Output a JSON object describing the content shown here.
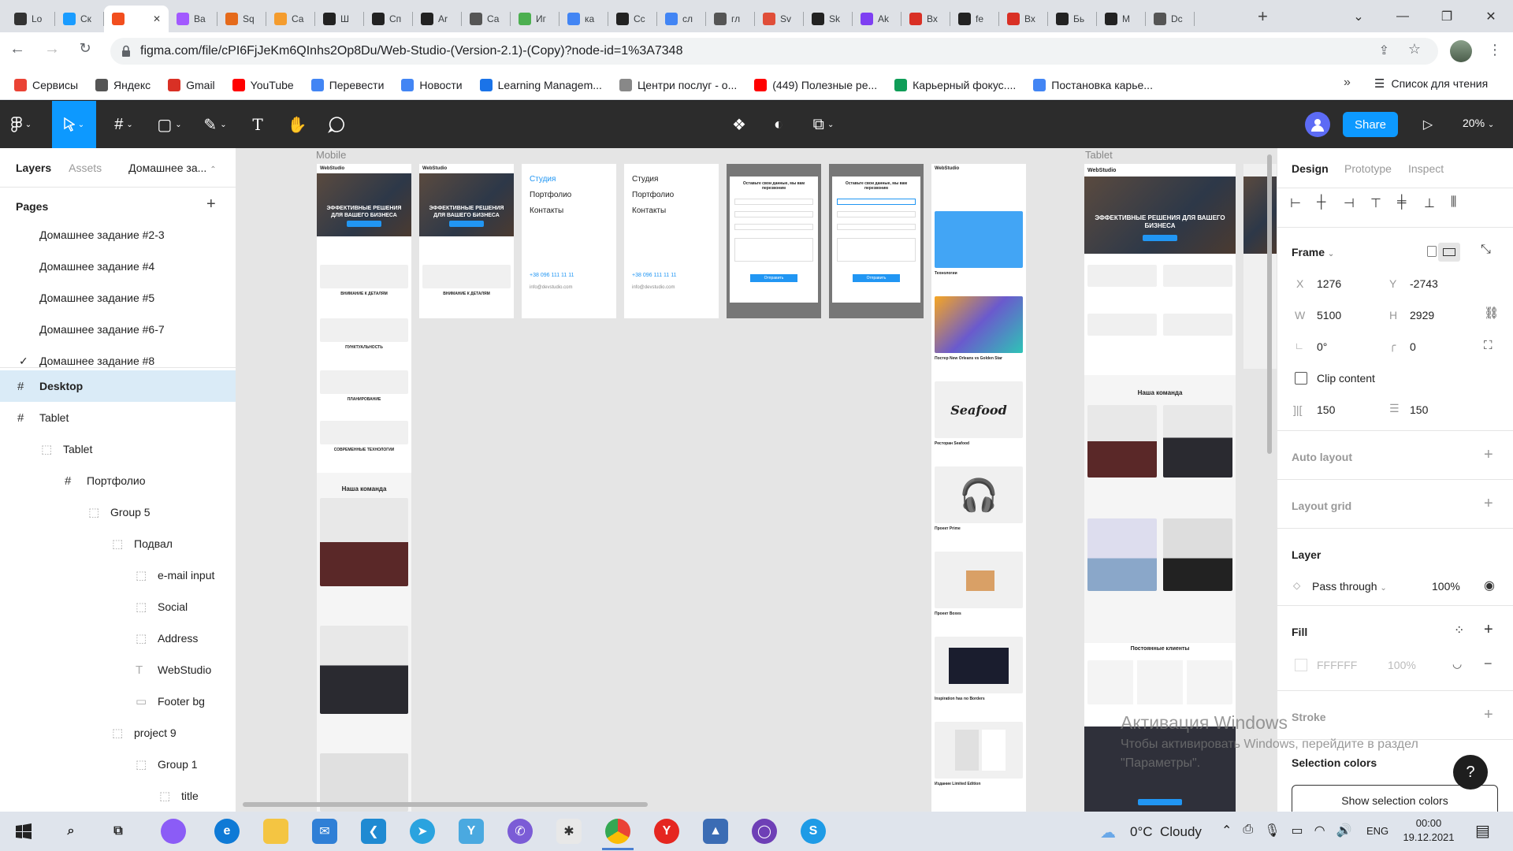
{
  "browser": {
    "tabs": [
      {
        "label": "Lo",
        "icon": "s-icon",
        "color": "#333"
      },
      {
        "label": "Cк",
        "icon": "globe-icon",
        "color": "#1a9cff"
      },
      {
        "label": "",
        "icon": "figma-icon",
        "color": "#f24e1e",
        "active": true
      },
      {
        "label": "Ва",
        "icon": "figma-icon",
        "color": "#a259ff"
      },
      {
        "label": "Sq",
        "icon": "s-icon",
        "color": "#e56a1b"
      },
      {
        "label": "Са",
        "icon": "mc-icon",
        "color": "#f49c2e"
      },
      {
        "label": "Ш",
        "icon": "w-icon",
        "color": "#222"
      },
      {
        "label": "Сп",
        "icon": "w-icon",
        "color": "#222"
      },
      {
        "label": "Ar",
        "icon": "diamond-icon",
        "color": "#222"
      },
      {
        "label": "Са",
        "icon": "globe-icon",
        "color": "#555"
      },
      {
        "label": "Иг",
        "icon": "n-icon",
        "color": "#4caf50"
      },
      {
        "label": "ка",
        "icon": "google-icon",
        "color": "#4285f4"
      },
      {
        "label": "Сс",
        "icon": "openai-icon",
        "color": "#222"
      },
      {
        "label": "сл",
        "icon": "google-icon",
        "color": "#4285f4"
      },
      {
        "label": "гл",
        "icon": "globe-icon",
        "color": "#555"
      },
      {
        "label": "Sv",
        "icon": "code-icon",
        "color": "#e04e39"
      },
      {
        "label": "Sk",
        "icon": "openai-icon",
        "color": "#222"
      },
      {
        "label": "Ak",
        "icon": "b-icon",
        "color": "#7e3ff2"
      },
      {
        "label": "Вх",
        "icon": "gmail-icon",
        "color": "#d93025"
      },
      {
        "label": "fe",
        "icon": "github-icon",
        "color": "#222"
      },
      {
        "label": "Вх",
        "icon": "gmail-icon",
        "color": "#d93025"
      },
      {
        "label": "Бь",
        "icon": "chart-icon",
        "color": "#222"
      },
      {
        "label": "М",
        "icon": "github-icon",
        "color": "#222"
      },
      {
        "label": "Dc",
        "icon": "globe-icon",
        "color": "#555"
      }
    ],
    "url": "figma.com/file/cPI6FjJeKm6QInhs2Op8Du/Web-Studio-(Version-2.1)-(Copy)?node-id=1%3A7348",
    "bookmarks": [
      {
        "label": "Сервисы",
        "color": "#ea4335"
      },
      {
        "label": "Яндекс",
        "color": "#555"
      },
      {
        "label": "Gmail",
        "color": "#d93025"
      },
      {
        "label": "YouTube",
        "color": "#ff0000"
      },
      {
        "label": "Перевести",
        "color": "#4285f4"
      },
      {
        "label": "Новости",
        "color": "#4285f4"
      },
      {
        "label": "Learning Managem...",
        "color": "#1a73e8"
      },
      {
        "label": "Центри послуг - о...",
        "color": "#888"
      },
      {
        "label": "(449) Полезные ре...",
        "color": "#ff0000"
      },
      {
        "label": "Карьерный фокус....",
        "color": "#0f9d58"
      },
      {
        "label": "Постановка карье...",
        "color": "#4285f4"
      }
    ],
    "reading_list": "Список для чтения"
  },
  "figma": {
    "share": "Share",
    "zoom": "20%",
    "left": {
      "tab_layers": "Layers",
      "tab_assets": "Assets",
      "page_switch": "Домашнее за...",
      "pages_title": "Pages",
      "pages": [
        "Домашнее задание #2-3",
        "Домашнее задание #4",
        "Домашнее задание #5",
        "Домашнее задание #6-7",
        "Домашнее задание #8"
      ],
      "layers": [
        "Desktop",
        "Tablet",
        "Tablet",
        "Портфолио",
        "Group 5",
        "Подвал",
        "e-mail input",
        "Social",
        "Address",
        "WebStudio",
        "Footer bg",
        "project 9",
        "Group 1",
        "title"
      ]
    },
    "canvas": {
      "label_mobile": "Mobile",
      "label_tablet": "Tablet",
      "brand": "WebStudio",
      "hero_title": "ЭФФЕКТИВНЫЕ РЕШЕНИЯ ДЛЯ ВАШЕГО БИЗНЕСА",
      "team_title": "Наша команда",
      "clients_title": "Постоянные клиенты",
      "menu_items": [
        "Студия",
        "Портфолио",
        "Контакты"
      ],
      "phone": "+38 096 111 11 11",
      "email": "info@devstudio.com",
      "modal_title": "Оставьте свои данные, мы вам перезвоним",
      "modal_button": "Отправить",
      "feature_1": "ВНИМАНИЕ К ДЕТАЛЯМ",
      "feature_2": "ПУНКТУАЛЬНОСТЬ",
      "feature_3": "ПЛАНИРОВАНИЕ",
      "feature_4": "СОВРЕМЕННЫЕ ТЕХНОЛОГИИ",
      "card_1": "Технологии",
      "card_2": "Постер New Orleans vs Golden Star",
      "card_3": "Ресторан Seafood",
      "card_4": "Проект Prime",
      "card_5": "Проект Boxes",
      "card_6": "Inspiration has no Borders",
      "card_7": "Издание Limited Edition"
    },
    "right": {
      "tab_design": "Design",
      "tab_prototype": "Prototype",
      "tab_inspect": "Inspect",
      "frame_label": "Frame",
      "x_label": "X",
      "x": "1276",
      "y_label": "Y",
      "y": "-2743",
      "w_label": "W",
      "w": "5100",
      "h_label": "H",
      "h": "2929",
      "rotation": "0°",
      "radius": "0",
      "clip_content": "Clip content",
      "spacing_h": "150",
      "spacing_v": "150",
      "auto_layout": "Auto layout",
      "layout_grid": "Layout grid",
      "layer": "Layer",
      "blend": "Pass through",
      "opacity": "100%",
      "fill": "Fill",
      "fill_hex": "FFFFFF",
      "fill_opacity": "100%",
      "stroke": "Stroke",
      "selection_colors": "Selection colors",
      "show_selection_colors": "Show selection colors"
    },
    "watermark_title": "Активация Windows",
    "watermark_line1": "Чтобы активировать Windows, перейдите в раздел",
    "watermark_line2": "\"Параметры\"."
  },
  "taskbar": {
    "weather": "0°C  Cloudy",
    "lang": "ENG",
    "time": "00:00",
    "date": "19.12.2021"
  },
  "colors": {
    "figma_blue": "#0d99ff",
    "selection": "#daebf7",
    "toolbar": "#2c2c2c"
  }
}
